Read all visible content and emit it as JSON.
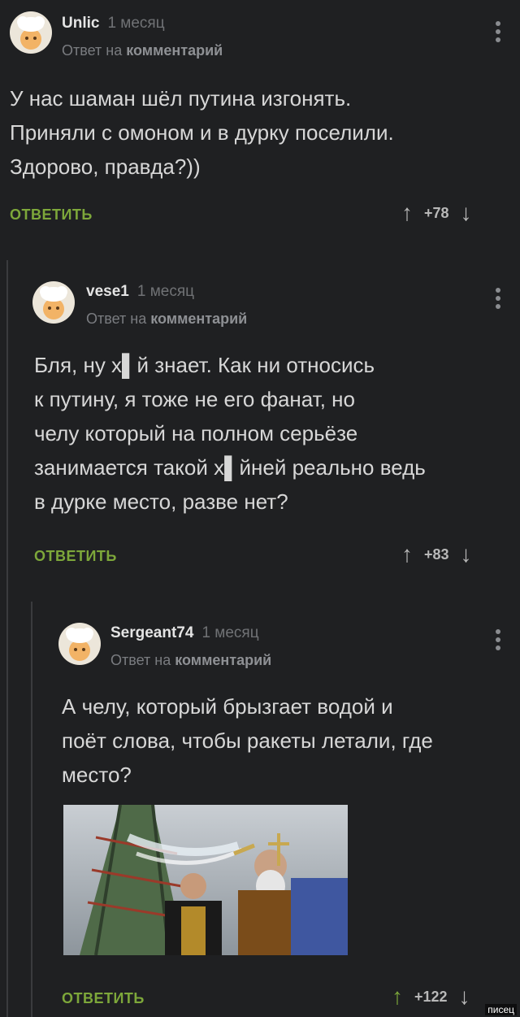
{
  "colors": {
    "background": "#1f2022",
    "accent_green": "#7da73a",
    "thread_line": "#3a3b3e"
  },
  "comments": [
    {
      "author": "Unlic",
      "time": "1 месяц",
      "reply_prefix": "Ответ на",
      "reply_link": "комментарий",
      "text": "У нас шаман шёл путина изгонять.\nПриняли с омоном и в дурку поселили.\n Здорово, правда?))",
      "reply_label": "ОТВЕТИТЬ",
      "score": "+78"
    },
    {
      "author": "vese1",
      "time": "1 месяц",
      "reply_prefix": "Ответ на",
      "reply_link": "комментарий",
      "text": "Бля, ну х▌й знает. Как ни относись\nк путину, я тоже не его фанат, но\nчелу который на полном серьёзе\nзанимается такой х▌йней реально ведь\nв дурке место, разве нет?",
      "reply_label": "ОТВЕТИТЬ",
      "score": "+83"
    },
    {
      "author": "Sergeant74",
      "time": "1 месяц",
      "reply_prefix": "Ответ на",
      "reply_link": "комментарий",
      "text": "А челу, который брызгает водой и\nпоёт слова, чтобы ракеты летали, где\nместо?",
      "reply_label": "ОТВЕТИТЬ",
      "score": "+122"
    }
  ],
  "icons": {
    "avatar": "chef-avatar-icon",
    "more": "more-vertical-icon",
    "upvote": "arrow-up-icon",
    "downvote": "arrow-down-icon"
  },
  "watermark": "писец"
}
